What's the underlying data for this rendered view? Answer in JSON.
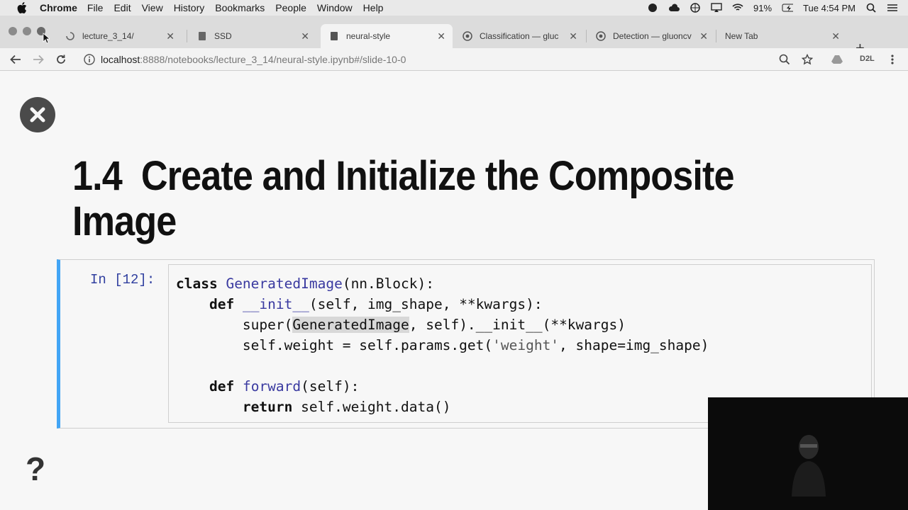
{
  "menubar": {
    "app": "Chrome",
    "items": [
      "File",
      "Edit",
      "View",
      "History",
      "Bookmarks",
      "People",
      "Window",
      "Help"
    ],
    "battery": "91%",
    "clock": "Tue 4:54 PM"
  },
  "tabs": [
    {
      "title": "lecture_3_14/",
      "icon": "loading-icon"
    },
    {
      "title": "SSD",
      "icon": "notebook-icon"
    },
    {
      "title": "neural-style",
      "icon": "notebook-icon",
      "active": true
    },
    {
      "title": "Classification — gluc",
      "icon": "chrome-icon"
    },
    {
      "title": "Detection — gluoncv",
      "icon": "chrome-icon"
    },
    {
      "title": "New Tab",
      "icon": ""
    }
  ],
  "omnibox": {
    "host": "localhost",
    "path": ":8888/notebooks/lecture_3_14/neural-style.ipynb#/slide-10-0"
  },
  "toolbar": {
    "extension_label": "D2L"
  },
  "slide": {
    "number": "1.4",
    "title_line1": "Create and Initialize the Composite",
    "title_line2": "Image"
  },
  "cell": {
    "prompt": "In [12]:",
    "code": {
      "l1_kw": "class",
      "l1_name": "GeneratedImage",
      "l1_rest": "(nn.Block):",
      "l2_kw": "def",
      "l2_name": "__init__",
      "l2_rest": "(self, img_shape, **kwargs):",
      "l3_pre": "super(",
      "l3_hl": "GeneratedImage",
      "l3_rest": ", self).__init__(**kwargs)",
      "l4_pre": "self.weight = self.params.get(",
      "l4_str": "'weight'",
      "l4_rest": ", shape=img_shape)",
      "l6_kw": "def",
      "l6_name": "forward",
      "l6_rest": "(self):",
      "l7_kw": "return",
      "l7_rest": "self.weight.data()"
    }
  },
  "help_symbol": "?",
  "colors": {
    "cell_border": "#42a5f5",
    "prompt": "#303f9f"
  }
}
